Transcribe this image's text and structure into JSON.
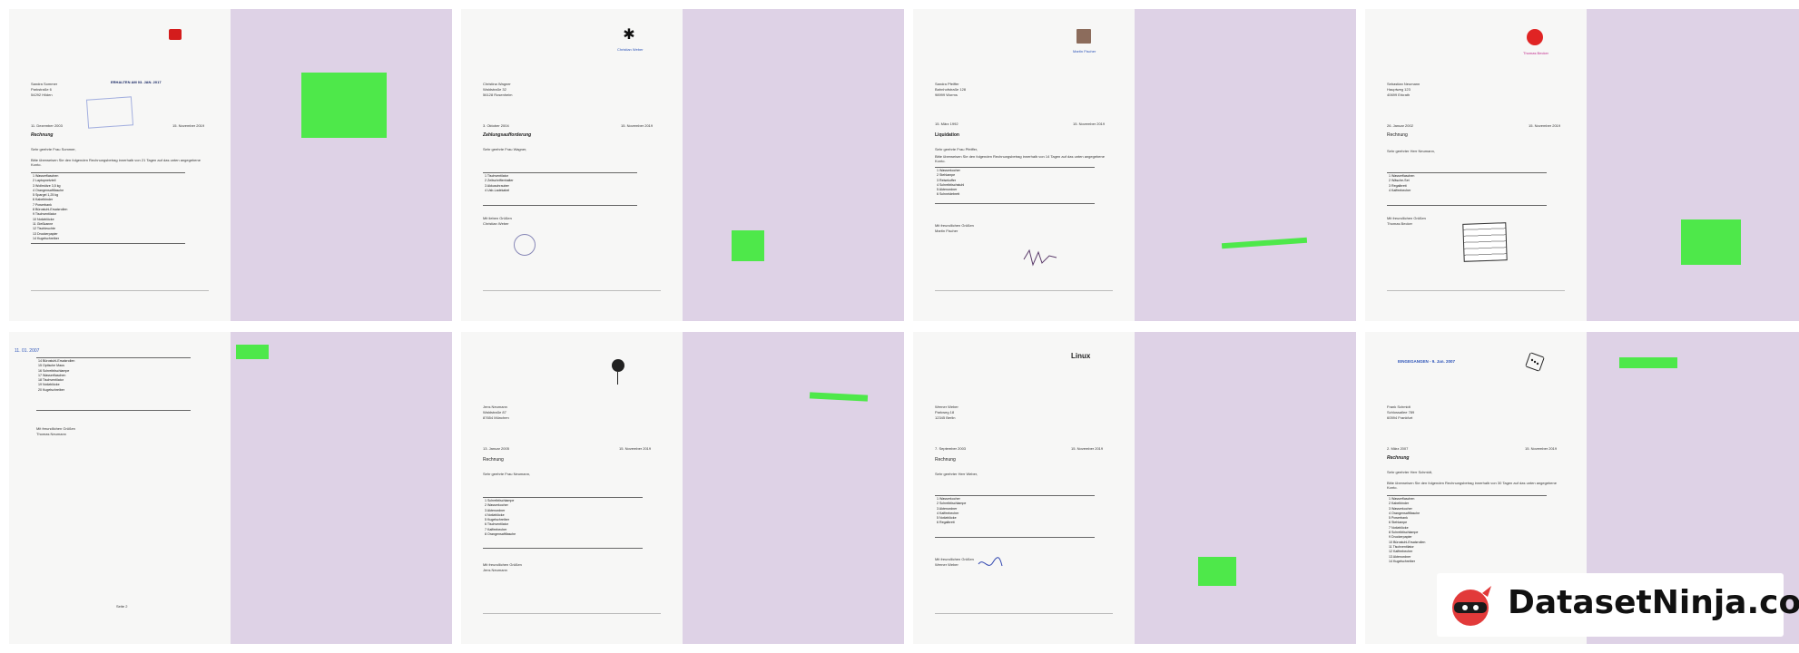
{
  "brand": {
    "name": "DatasetNinja.com",
    "logo_icon": "ninja-logo-icon"
  },
  "colors": {
    "panel_background": "#ded2e6",
    "document_paper": "#f7f7f6",
    "annotation_marker": "#4ee84a",
    "stamp_blue": "#2d54b8"
  },
  "tiles": [
    {
      "id": 1,
      "logo_icon": "red-square-logo-icon",
      "recipient": [
        "Sandra Sommer",
        "Parkstraße 6",
        "54292 Hilden"
      ],
      "stamp": "ERHALTEN AM 03. JAN. 2017",
      "dates": [
        "11. Dezember 2003",
        "15. November 2019"
      ],
      "title": "Rechnung",
      "greeting": "Sehr geehrte Frau Sommer,",
      "intro": "Bitte überweisen Sie den folgenden Rechnungsbetrag innerhalb von 21 Tagen auf das unten angegebene Konto.",
      "rows": [
        "1  Wasserflaschen",
        "2  Laptopnetzteil",
        "3  Wollmütze 3,5 kg",
        "4  Orangensaftflasche",
        "5  Spargel 1,25 kg",
        "6  Kabelbinder",
        "7  Powerbank",
        "8  Bürostuhl-Ersatzrollen",
        "9  Tischventilator",
        "10 Notizblöcke",
        "11 Gießkanne",
        "12 Tischleuchte",
        "13 Druckerpapier",
        "14 Kugelschreiber"
      ]
    },
    {
      "id": 2,
      "logo_icon": "asterisk-logo-icon",
      "sender_name": "Christian Weber",
      "recipient": [
        "Christina Wagner",
        "Waldstraße 32",
        "56128 Rosenheim"
      ],
      "dates": [
        "3. Oktober 2004",
        "15. November 2019"
      ],
      "title": "Zahlungsaufforderung",
      "greeting": "Sehr geehrte Frau Wagner,",
      "rows": [
        "1  Tischventilator",
        "2  Zeitschriftenhalter",
        "3  Akkuschrauber",
        "4  Usb-Ladekabel"
      ],
      "closing": [
        "Mit lieben Grüßen",
        "Christian Weber"
      ]
    },
    {
      "id": 3,
      "logo_icon": "brown-square-logo-icon",
      "sender_name": "Martin Fischer",
      "recipient": [
        "Sandra Pfeiffer",
        "Bahnhofstraße 128",
        "98999 Worms"
      ],
      "dates": [
        "15. März 1992",
        "15. November 2019"
      ],
      "title": "Liquidation",
      "greeting": "Sehr geehrte Frau Pfeiffer,",
      "intro": "Bitte überweisen Sie den folgenden Rechnungsbetrag innerhalb von 14 Tagen auf das unten angegebene Konto.",
      "rows": [
        "1  Wasserkocher",
        "2  Stehlampe",
        "3  Reisekoffer",
        "4  Schreibtischstuhl",
        "5  Aktenordner",
        "6  Schneidebrett"
      ],
      "closing": [
        "Mit freundlichen Grüßen",
        "Martin Fischer"
      ]
    },
    {
      "id": 4,
      "logo_icon": "red-blob-logo-icon",
      "sender_name": "Thomas Becker",
      "recipient": [
        "Sebastian Neumann",
        "Hauptweg 123",
        "40699 Erkrath"
      ],
      "dates": [
        "26. Januar 2002",
        "15. November 2019"
      ],
      "title": "Rechnung",
      "greeting": "Sehr geehrter Herr Neumann,",
      "rows": [
        "1  Wasserflaschen",
        "2  Wäsche-Set",
        "3  Regalbrett",
        "4  Kaffeebecher"
      ],
      "closing": [
        "Mit freundlichen Grüßen",
        "Thomas Becker"
      ]
    },
    {
      "id": 5,
      "stamp": "11. 01. 2007",
      "rows": [
        "14  Bürostuhl-Ersatzrollen",
        "15  Optische Maus",
        "16  Schreibtischlampe",
        "17  Wasserflaschen",
        "18  Tischventilator",
        "19  Notizblöcke",
        "20  Kugelschreiber"
      ],
      "closing": [
        "Mit freundlichen Grüßen",
        "Thomas Neumann"
      ],
      "page": "Seite 2"
    },
    {
      "id": 6,
      "logo_icon": "tree-logo-icon",
      "recipient": [
        "Jens Neumann",
        "Waldstraße 87",
        "87654 München"
      ],
      "dates": [
        "13. Januar 2005",
        "15. November 2019"
      ],
      "title": "Rechnung",
      "greeting": "Sehr geehrte Frau Neumann,",
      "rows": [
        "1  Schreibtischlampe",
        "2  Wasserkocher",
        "3  Aktenordner",
        "4  Notizblöcke",
        "5  Kugelschreiber",
        "6  Tischventilator",
        "7  Kaffeebecher",
        "8  Orangensaftflasche"
      ],
      "closing": [
        "Mit freundlichen Grüßen",
        "Jens Neumann"
      ]
    },
    {
      "id": 7,
      "logo_icon": "linux-logo-icon",
      "logo_text": "Linux",
      "recipient": [
        "Werner Weber",
        "Parkweg 18",
        "12345 Berlin"
      ],
      "dates": [
        "7. September 2003",
        "15. November 2019"
      ],
      "title": "Rechnung",
      "greeting": "Sehr geehrter Herr Weber,",
      "rows": [
        "1  Wasserkocher",
        "2  Schreibtischlampe",
        "3  Aktenordner",
        "4  Kaffeebecher",
        "5  Notizblöcke",
        "6  Regalbrett"
      ],
      "closing": [
        "Mit freundlichen Grüßen",
        "Werner Weber"
      ]
    },
    {
      "id": 8,
      "logo_icon": "dice-logo-icon",
      "stamp": "EINGEGANGEN - 9. Jan. 2007",
      "recipient": [
        "Frank Schmidt",
        "Schlossallee 789",
        "60594 Frankfurt"
      ],
      "dates": [
        "2. März 2007",
        "15. November 2019"
      ],
      "title": "Rechnung",
      "greeting": "Sehr geehrter Herr Schmidt,",
      "intro": "Bitte überweisen Sie den folgenden Rechnungsbetrag innerhalb von 30 Tagen auf das unten angegebene Konto.",
      "rows": [
        "1  Wasserflaschen",
        "2  Kabelbinder",
        "3  Wasserkocher",
        "4  Orangensaftflasche",
        "5  Powerbank",
        "6  Stehlampe",
        "7  Notizblöcke",
        "8  Schreibtischlampe",
        "9  Druckerpapier",
        "10 Bürostuhl-Ersatzrollen",
        "11 Tischventilator",
        "12 Kaffeebecher",
        "13 Aktenordner",
        "14 Kugelschreiber"
      ]
    }
  ]
}
